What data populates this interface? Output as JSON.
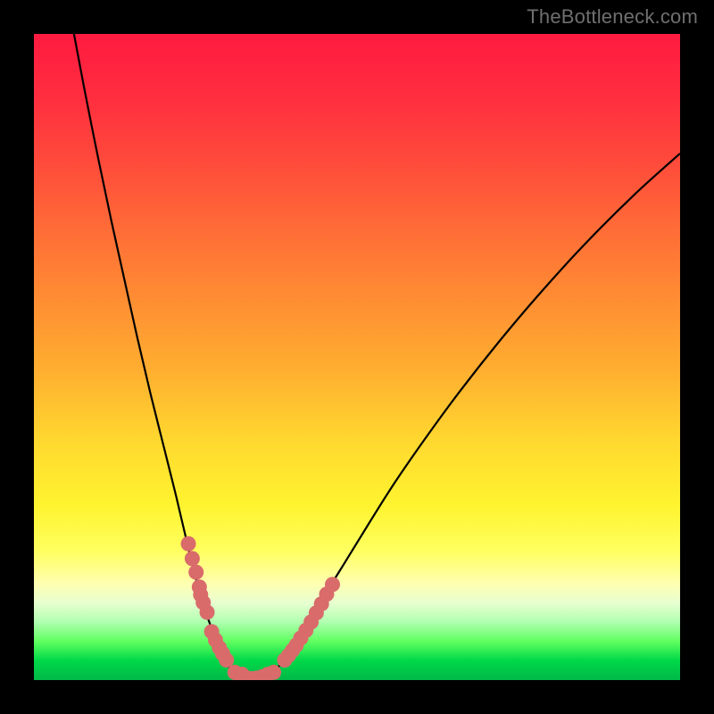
{
  "watermark": "TheBottleneck.com",
  "chart_data": {
    "type": "line",
    "title": "",
    "xlabel": "",
    "ylabel": "",
    "xlim": [
      0,
      1
    ],
    "ylim": [
      0,
      1
    ],
    "series": [
      {
        "name": "curve",
        "x": [
          0.062,
          0.08,
          0.1,
          0.12,
          0.14,
          0.16,
          0.18,
          0.2,
          0.22,
          0.24,
          0.258,
          0.275,
          0.289,
          0.302,
          0.314,
          0.323,
          0.333,
          0.345,
          0.363,
          0.383,
          0.403,
          0.44,
          0.48,
          0.52,
          0.56,
          0.61,
          0.66,
          0.72,
          0.78,
          0.85,
          0.93,
          1.0
        ],
        "y": [
          1.0,
          0.905,
          0.805,
          0.71,
          0.62,
          0.53,
          0.445,
          0.365,
          0.285,
          0.2,
          0.13,
          0.08,
          0.045,
          0.02,
          0.008,
          0.002,
          0.002,
          0.003,
          0.01,
          0.025,
          0.05,
          0.115,
          0.18,
          0.245,
          0.308,
          0.38,
          0.448,
          0.524,
          0.595,
          0.672,
          0.752,
          0.815
        ]
      },
      {
        "name": "dot-cluster-left",
        "x": [
          0.239,
          0.245,
          0.251,
          0.258,
          0.256,
          0.262,
          0.268,
          0.275,
          0.281,
          0.287,
          0.292,
          0.298
        ],
        "y": [
          0.211,
          0.188,
          0.167,
          0.132,
          0.144,
          0.12,
          0.105,
          0.075,
          0.062,
          0.05,
          0.041,
          0.031
        ]
      },
      {
        "name": "dot-cluster-bottom",
        "x": [
          0.311,
          0.319,
          0.322,
          0.33,
          0.338,
          0.345,
          0.353,
          0.362,
          0.371
        ],
        "y": [
          0.012,
          0.004,
          0.009,
          0.003,
          0.002,
          0.003,
          0.005,
          0.009,
          0.012
        ]
      },
      {
        "name": "dot-cluster-right",
        "x": [
          0.388,
          0.394,
          0.4,
          0.406,
          0.413,
          0.421,
          0.429,
          0.437,
          0.445,
          0.453,
          0.462
        ],
        "y": [
          0.031,
          0.038,
          0.046,
          0.054,
          0.065,
          0.077,
          0.09,
          0.104,
          0.118,
          0.133,
          0.148
        ]
      }
    ],
    "colors": {
      "curve": "#000000",
      "dots": "#d96b6b"
    }
  }
}
